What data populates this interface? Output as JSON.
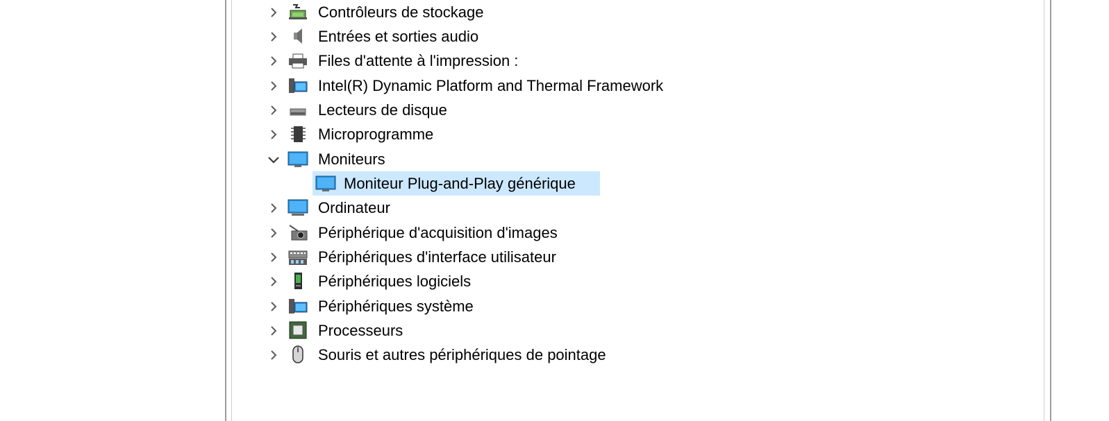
{
  "window": {
    "tree": {
      "items": [
        {
          "label": "Contrôleurs de stockage",
          "icon": "storage-controller-icon",
          "expanded": false
        },
        {
          "label": "Entrées et sorties audio",
          "icon": "speaker-icon",
          "expanded": false
        },
        {
          "label": "Files d'attente à l'impression :",
          "icon": "printer-icon",
          "expanded": false
        },
        {
          "label": "Intel(R) Dynamic Platform and Thermal Framework",
          "icon": "system-device-icon",
          "expanded": false
        },
        {
          "label": "Lecteurs de disque",
          "icon": "disk-drive-icon",
          "expanded": false
        },
        {
          "label": "Microprogramme",
          "icon": "firmware-chip-icon",
          "expanded": false
        },
        {
          "label": "Moniteurs",
          "icon": "monitor-icon",
          "expanded": true,
          "children": [
            {
              "label": "Moniteur Plug-and-Play générique",
              "icon": "monitor-icon",
              "selected": true
            }
          ]
        },
        {
          "label": "Ordinateur",
          "icon": "computer-icon",
          "expanded": false
        },
        {
          "label": "Périphérique d'acquisition d'images",
          "icon": "camera-icon",
          "expanded": false
        },
        {
          "label": "Périphériques d'interface utilisateur",
          "icon": "hid-keyboard-icon",
          "expanded": false
        },
        {
          "label": "Périphériques logiciels",
          "icon": "software-device-icon",
          "expanded": false
        },
        {
          "label": "Périphériques système",
          "icon": "system-device-icon",
          "expanded": false
        },
        {
          "label": "Processeurs",
          "icon": "processor-icon",
          "expanded": false
        },
        {
          "label": "Souris et autres périphériques de pointage",
          "icon": "mouse-icon",
          "expanded": false
        }
      ]
    }
  },
  "colors": {
    "selection": "#cce8ff",
    "monitor_blue": "#1e90e0"
  }
}
